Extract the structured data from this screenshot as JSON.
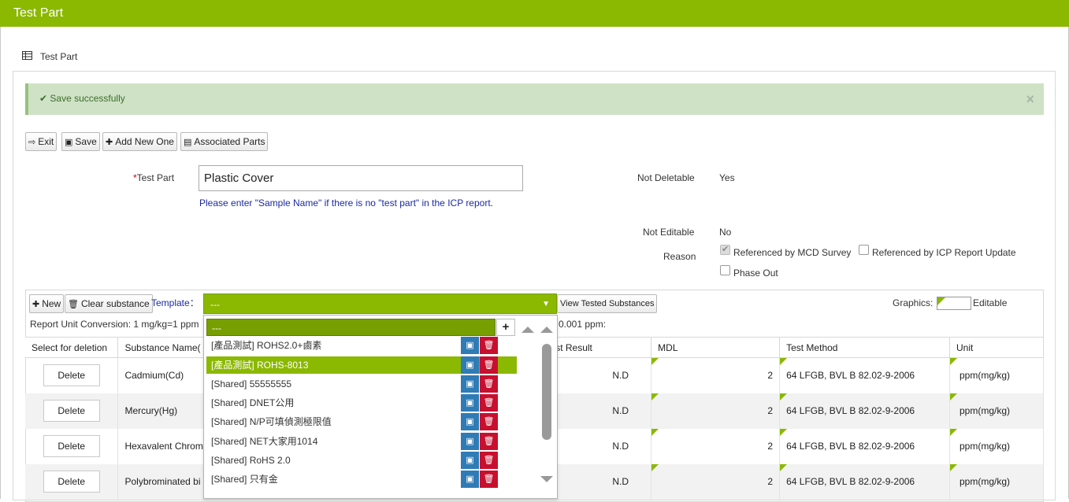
{
  "window": {
    "title": "Test Part"
  },
  "panel": {
    "title": "Test Part"
  },
  "alert": {
    "message": "Save successfully",
    "close_glyph": "×"
  },
  "toolbar": {
    "exit": "Exit",
    "save": "Save",
    "add_new": "Add New One",
    "associated": "Associated Parts"
  },
  "form": {
    "test_part_label": "Test Part",
    "test_part_required": "*",
    "test_part_value": "Plastic Cover",
    "hint": "Please enter \"Sample Name\" if there is no \"test part\" in the ICP report.",
    "not_deletable_label": "Not Deletable",
    "not_deletable_value": "Yes",
    "not_editable_label": "Not Editable",
    "not_editable_value": "No",
    "reason_label": "Reason",
    "reasons": [
      {
        "label": "Referenced by MCD Survey",
        "checked": true
      },
      {
        "label": "Referenced by ICP Report Update",
        "checked": false
      },
      {
        "label": "Phase Out",
        "checked": false
      }
    ]
  },
  "substances": {
    "new_label": "New",
    "clear_label": "Clear substance",
    "template_label": "Template：",
    "template_value": "---",
    "view_tested_label": "View Tested Substances",
    "graphics_label": "Graphics:",
    "editable_label": "Editable",
    "conversion_left": "Report Unit Conversion: 1 mg/kg=1 ppm",
    "conversion_right": "0.001 ppm:",
    "columns": [
      "Select for deletion",
      "Substance Name(",
      "st Result",
      "MDL",
      "Test Method",
      "Unit"
    ],
    "delete_label": "Delete",
    "rows": [
      {
        "name": "Cadmium(Cd)",
        "result": "N.D",
        "mdl": "2",
        "method": "64 LFGB, BVL B 82.02-9-2006",
        "unit": "ppm(mg/kg)"
      },
      {
        "name": "Mercury(Hg)",
        "result": "N.D",
        "mdl": "2",
        "method": "64 LFGB, BVL B 82.02-9-2006",
        "unit": "ppm(mg/kg)"
      },
      {
        "name": "Hexavalent Chrom",
        "result": "N.D",
        "mdl": "2",
        "method": "64 LFGB, BVL B 82.02-9-2006",
        "unit": "ppm(mg/kg)"
      },
      {
        "name": "Polybrominated bi",
        "result": "N.D",
        "mdl": "2",
        "method": "64 LFGB, BVL B 82.02-9-2006",
        "unit": "ppm(mg/kg)"
      }
    ]
  },
  "dropdown": {
    "search_value": "---",
    "add_glyph": "+",
    "items": [
      {
        "label": "[產品測試] ROHS2.0+鹵素",
        "selected": false
      },
      {
        "label": "[產品測試] ROHS-8013",
        "selected": true
      },
      {
        "label": "[Shared] 55555555",
        "selected": false
      },
      {
        "label": "[Shared] DNET公用",
        "selected": false
      },
      {
        "label": "[Shared] N/P可填偵測極限值",
        "selected": false
      },
      {
        "label": "[Shared] NET大家用1014",
        "selected": false
      },
      {
        "label": "[Shared] RoHS 2.0",
        "selected": false
      },
      {
        "label": "[Shared] 只有金",
        "selected": false
      }
    ]
  },
  "icons": {
    "exit": "exit-icon",
    "save": "floppy-icon",
    "add": "plus-icon",
    "associated": "document-icon",
    "table": "table-icon",
    "check": "check-icon",
    "trash": "trash-icon"
  }
}
